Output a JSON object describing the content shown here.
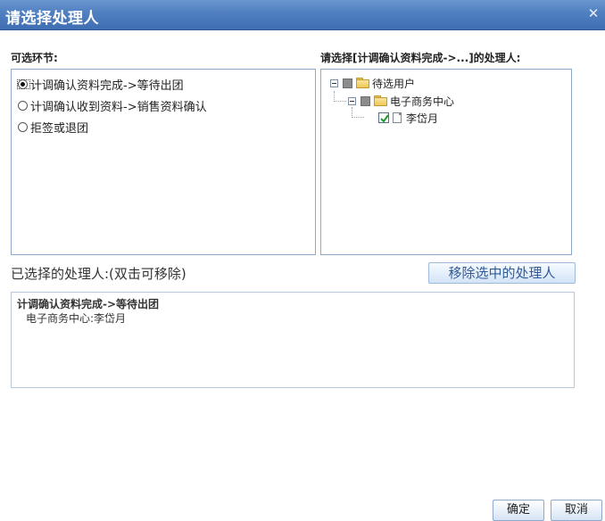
{
  "dialog": {
    "title": "请选择处理人"
  },
  "steps_section": {
    "label": "可选环节:",
    "options": [
      {
        "label": "计调确认资料完成->等待出团",
        "checked": true
      },
      {
        "label": "计调确认收到资料->销售资料确认",
        "checked": false
      },
      {
        "label": "拒签或退团",
        "checked": false
      }
    ]
  },
  "handler_section": {
    "label": "请选择[计调确认资料完成->...]的处理人:",
    "tree": {
      "root": "待选用户",
      "group": "电子商务中心",
      "user": "李岱月",
      "user_checked": true
    }
  },
  "selected_section": {
    "title": "已选择的处理人:(双击可移除)",
    "remove_button": "移除选中的处理人",
    "entries": [
      {
        "step": "计调确认资料完成->等待出团",
        "user": "电子商务中心:李岱月"
      }
    ]
  },
  "footer": {
    "ok_label": "确定",
    "cancel_label": "取消"
  },
  "colors": {
    "titlebar": "#4f7fc0",
    "panel_border": "#8fa9cb",
    "button_text": "#2f5a9a"
  }
}
